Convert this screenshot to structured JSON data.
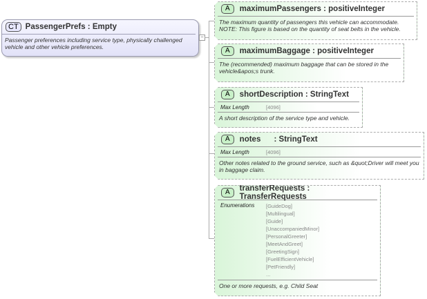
{
  "complex_type": {
    "badge": "CT",
    "name": "PassengerPrefs : Empty",
    "description": "Passenger preferences including service type, physically challenged vehicle and other vehicle preferences.",
    "collapse": "−"
  },
  "attributes": [
    {
      "badge": "A",
      "name": "maximumPassengers : positiveInteger",
      "description": "The maximum quantity of passengers this vehicle can accommodate. NOTE: This figure is based on the quantity of seat belts in the vehicle."
    },
    {
      "badge": "A",
      "name": "maximumBaggage : positiveInteger",
      "description": "The (recommended) maximum baggage that can be stored in the vehicle&apos;s trunk."
    },
    {
      "badge": "A",
      "name": "shortDescription : StringText",
      "prop_label": "Max Length",
      "prop_value": "[4096]",
      "description": "A short description of the service type and vehicle."
    },
    {
      "badge": "A",
      "name": "notes      : StringText",
      "prop_label": "Max Length",
      "prop_value": "[4096]",
      "description": "Other notes related to the ground service, such as &quot;Driver will meet you in baggage claim."
    },
    {
      "badge": "A",
      "name": "transferRequests : TransferRequests",
      "prop_label": "Enumerations",
      "enumerations": [
        "[GuideDog]",
        "[Multilingual]",
        "[Guide]",
        "[UnaccompaniedMinor]",
        "[PersonalGreeter]",
        "[MeetAndGreet]",
        "[GreetingSign]",
        "[FuelEfficientVehicle]",
        "[PetFriendly]",
        "..."
      ],
      "description": "One or more requests, e.g. Child Seat"
    }
  ]
}
